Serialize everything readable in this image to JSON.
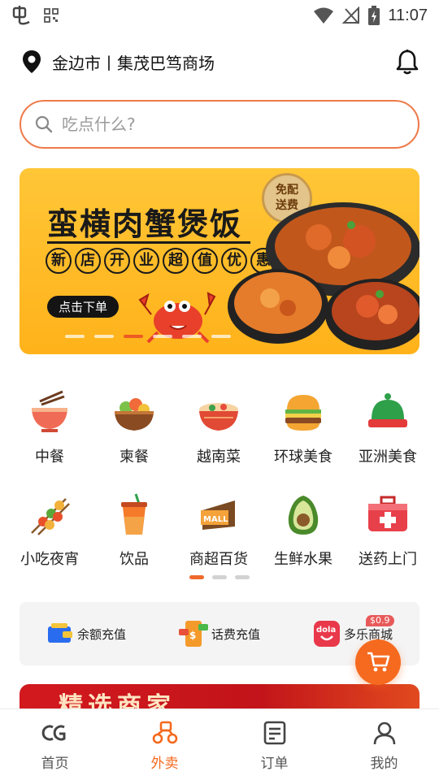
{
  "status_bar": {
    "time": "11:07"
  },
  "location": {
    "text": "金边市丨集茂巴笃商场"
  },
  "search": {
    "placeholder": "吃点什么?"
  },
  "banner": {
    "title": "蛮横肉蟹煲饭",
    "subtitle_chars": [
      "新",
      "店",
      "开",
      "业",
      "超",
      "值",
      "优",
      "惠"
    ],
    "button": "点击下单",
    "badge_line1": "免配",
    "badge_line2": "送费",
    "active_dot": 3,
    "dot_count": 6
  },
  "categories": [
    {
      "label": "中餐",
      "icon": "noodle-bowl-icon"
    },
    {
      "label": "柬餐",
      "icon": "salad-bowl-icon"
    },
    {
      "label": "越南菜",
      "icon": "pho-bowl-icon"
    },
    {
      "label": "环球美食",
      "icon": "burger-icon"
    },
    {
      "label": "亚洲美食",
      "icon": "cloche-icon"
    },
    {
      "label": "小吃夜宵",
      "icon": "skewers-icon"
    },
    {
      "label": "饮品",
      "icon": "drink-cup-icon"
    },
    {
      "label": "商超百货",
      "icon": "mall-icon"
    },
    {
      "label": "生鲜水果",
      "icon": "avocado-icon"
    },
    {
      "label": "送药上门",
      "icon": "medicine-kit-icon"
    }
  ],
  "services": [
    {
      "label": "余额充值",
      "icon": "wallet-icon"
    },
    {
      "label": "话费充值",
      "icon": "phone-topup-icon"
    },
    {
      "label": "多乐商城",
      "icon": "dola-icon",
      "badge": "$0.9"
    }
  ],
  "promo": {
    "text": "精选商家"
  },
  "tabs": [
    {
      "label": "首页",
      "icon": "home-logo-icon",
      "active": false
    },
    {
      "label": "外卖",
      "icon": "delivery-scooter-icon",
      "active": true
    },
    {
      "label": "订单",
      "icon": "order-list-icon",
      "active": false
    },
    {
      "label": "我的",
      "icon": "profile-icon",
      "active": false
    }
  ],
  "colors": {
    "accent": "#f5691e",
    "search_border": "#ee7a4a",
    "banner_bg": "#ffbf2b"
  }
}
